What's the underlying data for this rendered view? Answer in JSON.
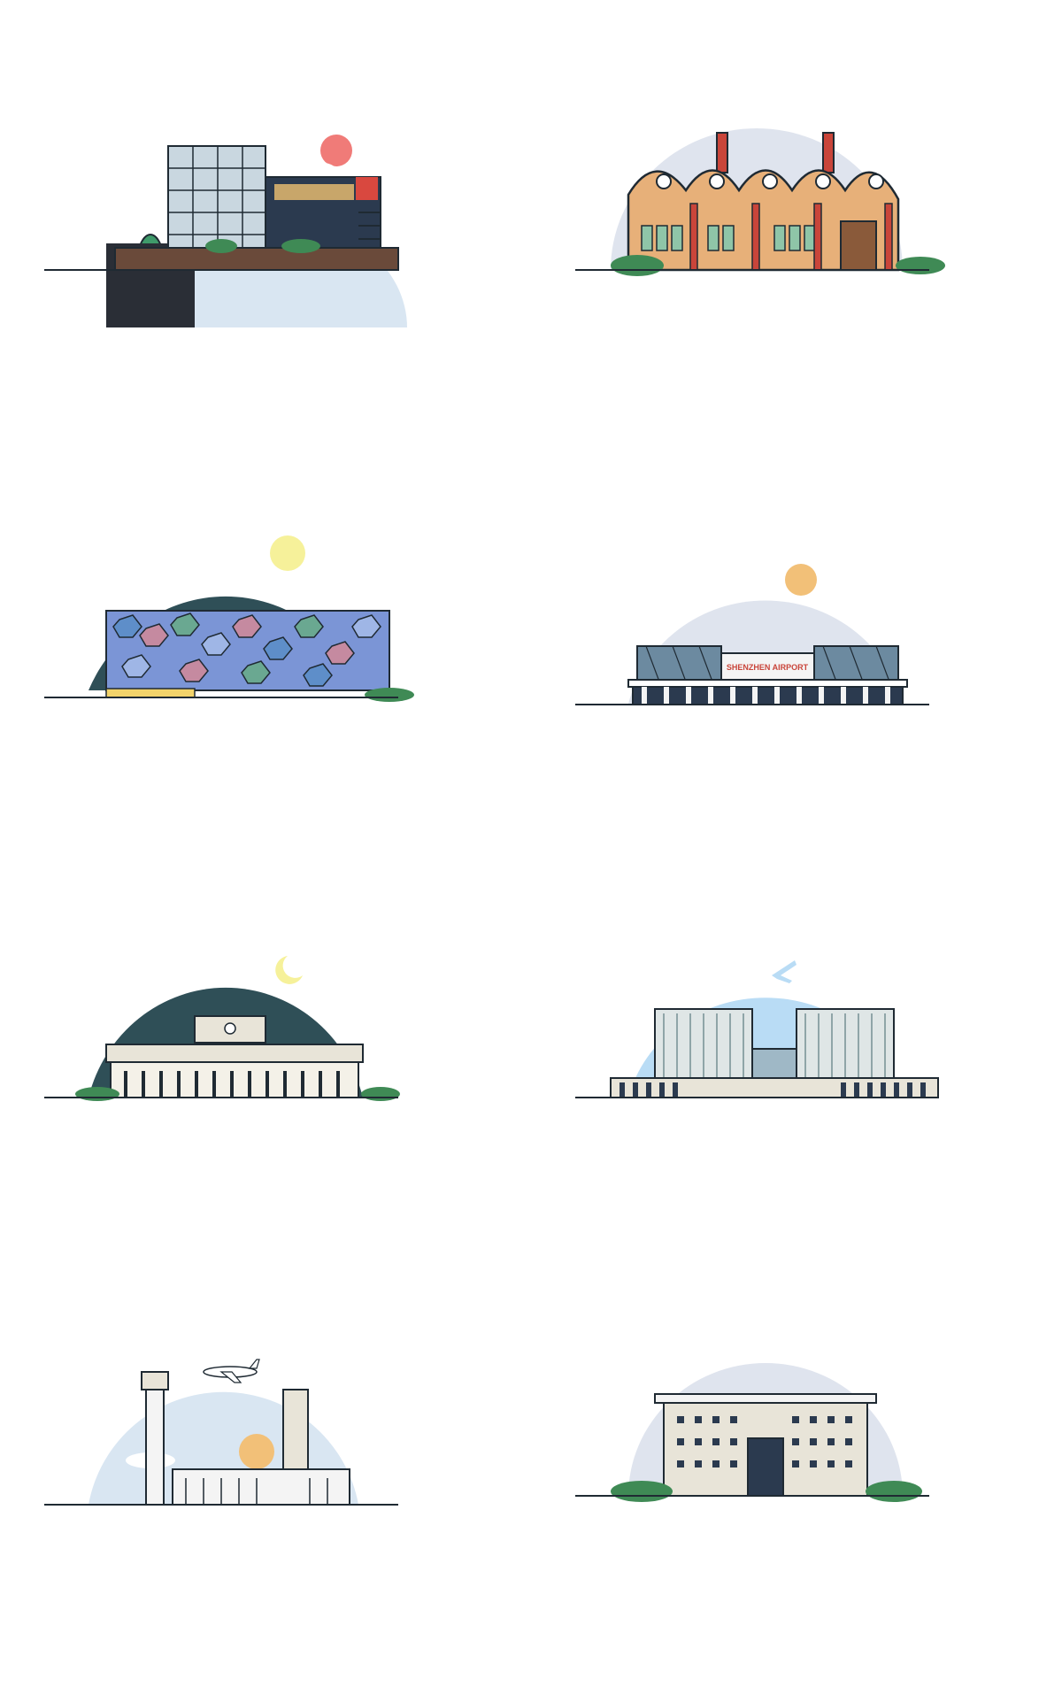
{
  "page": {
    "background": "#ffffff"
  },
  "colors": {
    "line": "#1f2a33",
    "ground": "#1f2a33",
    "sky_day": "#d9e6f2",
    "sky_pale": "#dfe4ee",
    "sky_blue": "#b9dcf5",
    "sky_night": "#2f4f57",
    "sun_red": "#f07b78",
    "sun_orange": "#f2c078",
    "moon": "#f6f19a",
    "bush": "#3f8a55",
    "brick": "#e7b079",
    "red_pipe": "#c9453a",
    "building_light": "#e8e4d8",
    "glass": "#9fb8c6"
  },
  "scenes": [
    {
      "id": "modern-villa",
      "sky": "day",
      "celestial": "sun"
    },
    {
      "id": "brick-factory",
      "sky": "pale",
      "celestial": "none"
    },
    {
      "id": "hexagon-pavilion",
      "sky": "night",
      "celestial": "moon-full"
    },
    {
      "id": "shenzhen-airport",
      "sky": "pale",
      "celestial": "sun",
      "sign": "SHENZHEN AIRPORT"
    },
    {
      "id": "night-terminal",
      "sky": "night",
      "celestial": "moon-crescent"
    },
    {
      "id": "twin-tower-office",
      "sky": "blue",
      "celestial": "airplane-badge"
    },
    {
      "id": "control-tower-airport",
      "sky": "day",
      "celestial": "sun",
      "extra": "airplane"
    },
    {
      "id": "government-hall",
      "sky": "pale",
      "celestial": "none"
    }
  ]
}
